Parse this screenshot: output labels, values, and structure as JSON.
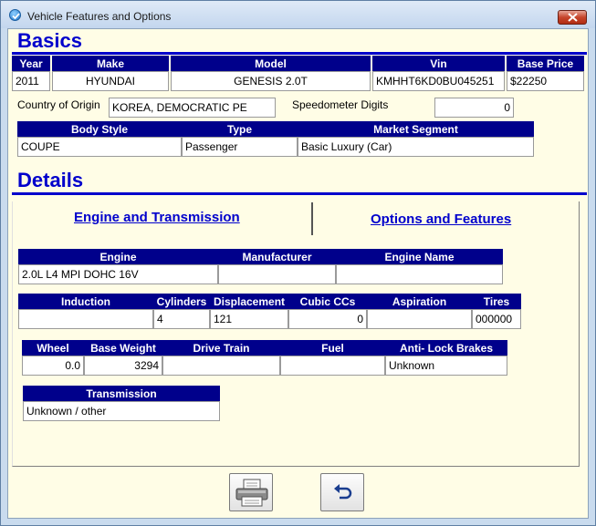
{
  "window": {
    "title": "Vehicle Features and Options"
  },
  "basics": {
    "title": "Basics",
    "headers": {
      "year": "Year",
      "make": "Make",
      "model": "Model",
      "vin": "Vin",
      "base_price": "Base Price"
    },
    "values": {
      "year": "2011",
      "make": "HYUNDAI",
      "model": "GENESIS 2.0T",
      "vin": "KMHHT6KD0BU045251",
      "base_price": "$22250"
    },
    "country_label": "Country of Origin",
    "country_value": "KOREA, DEMOCRATIC PE",
    "speedo_label": "Speedometer Digits",
    "speedo_value": "0",
    "body_headers": {
      "body_style": "Body Style",
      "type": "Type",
      "segment": "Market Segment"
    },
    "body_values": {
      "body_style": "COUPE",
      "type": "Passenger",
      "segment": "Basic Luxury (Car)"
    }
  },
  "details": {
    "title": "Details",
    "tabs": {
      "engine": "Engine and Transmission",
      "options": "Options and Features"
    },
    "engine_headers": {
      "engine": "Engine",
      "manufacturer": "Manufacturer",
      "engine_name": "Engine Name"
    },
    "engine_values": {
      "engine": "2.0L L4  MPI DOHC 16V",
      "manufacturer": "",
      "engine_name": ""
    },
    "induction_headers": {
      "induction": "Induction",
      "cylinders": "Cylinders",
      "displacement": "Displacement",
      "cubic_ccs": "Cubic CCs",
      "aspiration": "Aspiration",
      "tires": "Tires"
    },
    "induction_values": {
      "induction": "",
      "cylinders": "4",
      "displacement": "121",
      "cubic_ccs": "0",
      "aspiration": "",
      "tires": "000000"
    },
    "wheel_headers": {
      "wheel_base": "Wheel Base",
      "base_weight": "Base Weight",
      "drive_train": "Drive Train",
      "fuel": "Fuel",
      "abs": "Anti- Lock Brakes"
    },
    "wheel_values": {
      "wheel_base": "0.0",
      "base_weight": "3294",
      "drive_train": "",
      "fuel": "",
      "abs": "Unknown"
    },
    "transmission_header": "Transmission",
    "transmission_value": "Unknown / other"
  },
  "buttons": {
    "print_icon": "printer-icon",
    "back_icon": "undo-icon"
  },
  "colors": {
    "header_bg": "#00008b",
    "accent": "#0000cc",
    "background": "#fffde6"
  }
}
